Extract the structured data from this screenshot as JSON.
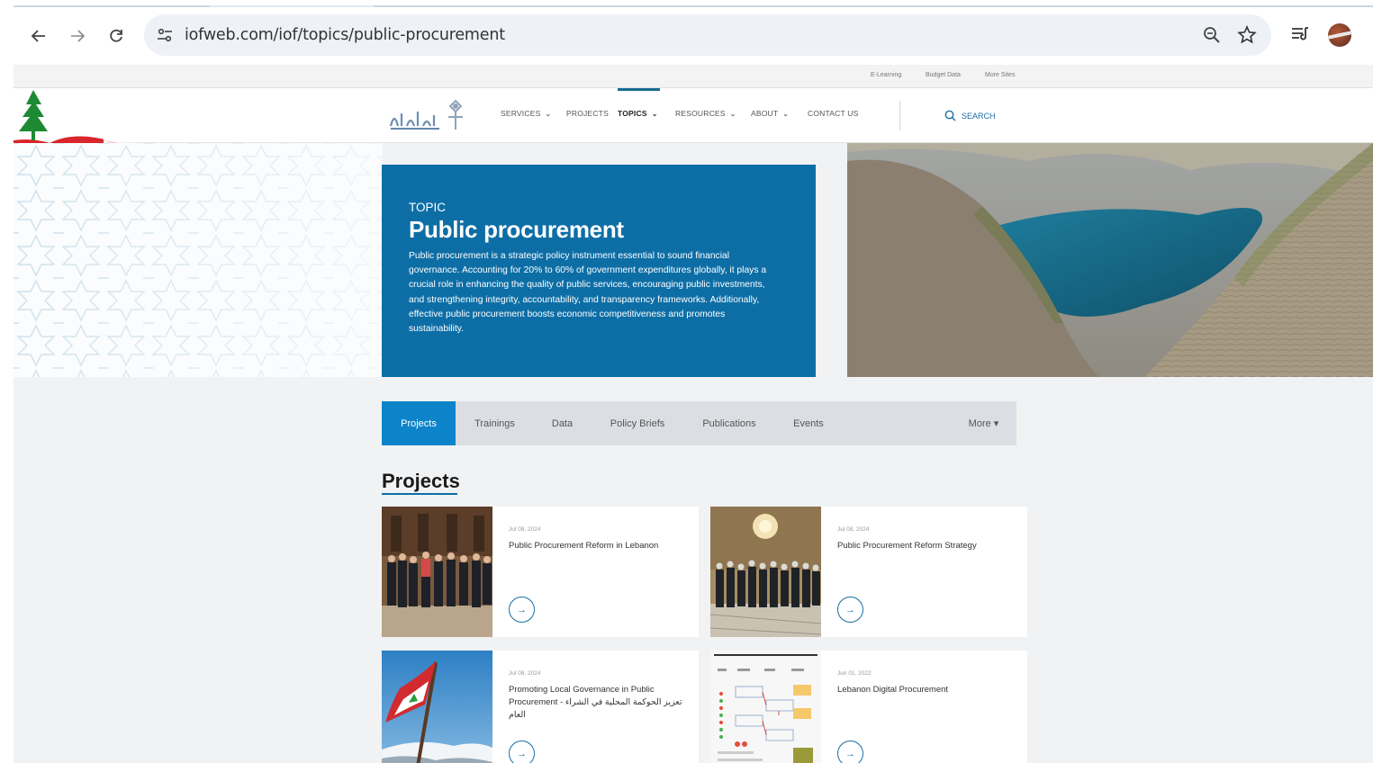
{
  "browser": {
    "url": "iofweb.com/iof/topics/public-procurement"
  },
  "utility_links": [
    "E-Learning",
    "Budget Data",
    "More Sites"
  ],
  "nav": {
    "items": [
      {
        "label": "SERVICES",
        "dropdown": true
      },
      {
        "label": "PROJECTS",
        "dropdown": false
      },
      {
        "label": "TOPICS",
        "dropdown": true,
        "active": true
      },
      {
        "label": "RESOURCES",
        "dropdown": true
      },
      {
        "label": "ABOUT",
        "dropdown": true
      },
      {
        "label": "CONTACT US",
        "dropdown": false
      }
    ],
    "search_label": "SEARCH"
  },
  "hero": {
    "kicker": "TOPIC",
    "title": "Public procurement",
    "description": "Public procurement is a strategic policy instrument essential to sound financial governance. Accounting for 20% to 60% of government expenditures globally, it plays a crucial role in enhancing the quality of public services, encouraging public investments, and strengthening integrity, accountability, and transparency frameworks. Additionally, effective public procurement boosts economic competitiveness and promotes sustainability."
  },
  "tabs": [
    {
      "label": "Projects",
      "active": true
    },
    {
      "label": "Trainings"
    },
    {
      "label": "Data"
    },
    {
      "label": "Policy Briefs"
    },
    {
      "label": "Publications"
    },
    {
      "label": "Events"
    }
  ],
  "tabs_more": "More ▾",
  "section_title": "Projects",
  "cards": [
    {
      "date": "Jul 08, 2024",
      "title": "Public Procurement Reform in Lebanon"
    },
    {
      "date": "Jul 08, 2024",
      "title": "Public Procurement Reform Strategy"
    },
    {
      "date": "Jul 08, 2024",
      "title": "Promoting Local Governance in Public Procurement - تعزيز الحوكمة المحلية في الشراء العام"
    },
    {
      "date": "Jun 01, 2022",
      "title": "Lebanon Digital Procurement"
    }
  ],
  "colors": {
    "brand_blue": "#0d6ea6",
    "tab_active": "#0d84c9"
  }
}
